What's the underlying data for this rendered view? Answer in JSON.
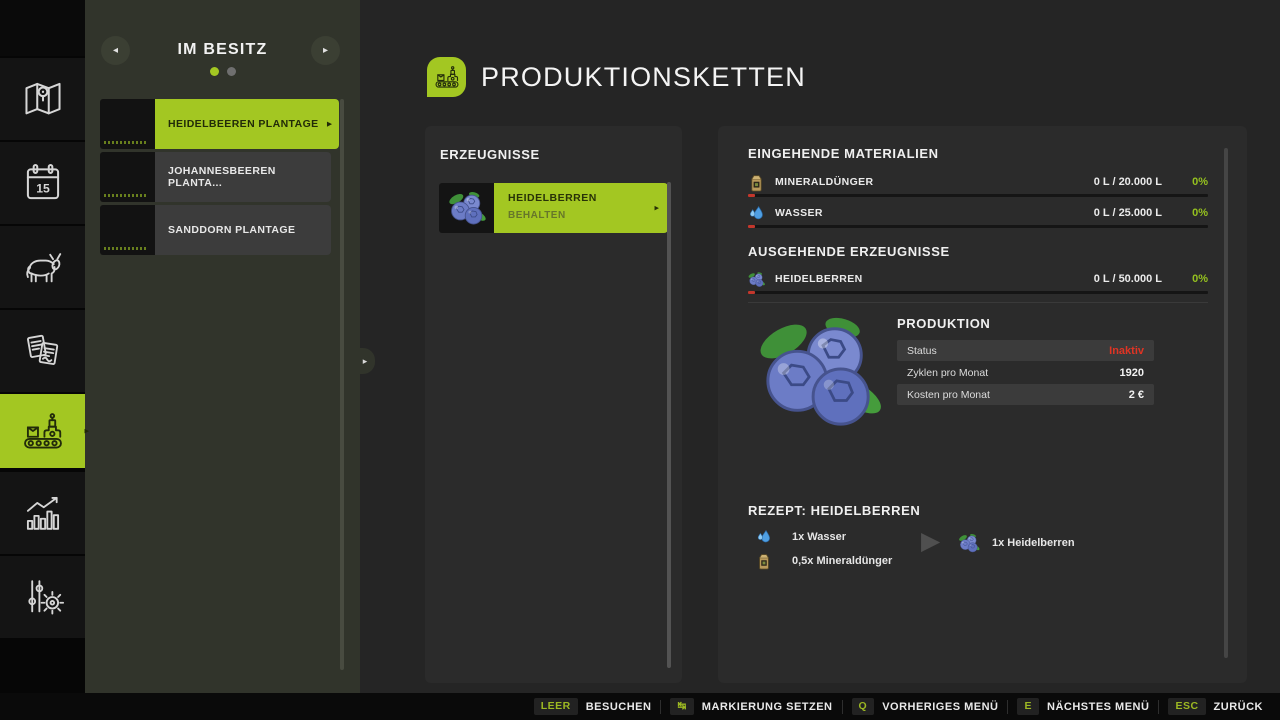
{
  "colors": {
    "accent": "#a3c722",
    "status_inactive": "#e03424",
    "percent_ok": "#95c11f"
  },
  "rail": {
    "icons": [
      "map-icon",
      "calendar-icon",
      "animals-icon",
      "contracts-icon",
      "production-icon",
      "statistics-icon",
      "settings-icon"
    ],
    "active_icon": "production-icon",
    "calendar_day": "15"
  },
  "own_panel": {
    "title": "IM BESITZ",
    "pages": 2,
    "active_page": 1,
    "items": [
      {
        "label": "HEIDELBEEREN PLANTAGE",
        "selected": true
      },
      {
        "label": "JOHANNESBEEREN PLANTA...",
        "selected": false
      },
      {
        "label": "SANDDORN PLANTAGE",
        "selected": false
      }
    ]
  },
  "header": {
    "title": "PRODUKTIONSKETTEN",
    "icon": "factory-icon"
  },
  "products": {
    "title": "ERZEUGNISSE",
    "item_name": "HEIDELBERREN",
    "item_sub": "BEHALTEN",
    "item_icon": "blueberries-icon"
  },
  "inputs": {
    "title": "EINGEHENDE MATERIALIEN",
    "rows": [
      {
        "icon": "fertilizer-icon",
        "name": "MINERALDÜNGER",
        "amount": "0 L / 20.000 L",
        "percent": "0%"
      },
      {
        "icon": "water-icon",
        "name": "WASSER",
        "amount": "0 L / 25.000 L",
        "percent": "0%"
      }
    ]
  },
  "outputs": {
    "title": "AUSGEHENDE ERZEUGNISSE",
    "rows": [
      {
        "icon": "blueberries-icon",
        "name": "HEIDELBERREN",
        "amount": "0 L / 50.000 L",
        "percent": "0%"
      }
    ]
  },
  "production": {
    "title": "PRODUKTION",
    "rows": [
      {
        "label": "Status",
        "value": "Inaktiv"
      },
      {
        "label": "Zyklen pro Monat",
        "value": "1920"
      },
      {
        "label": "Kosten pro Monat",
        "value": "2 €"
      }
    ]
  },
  "recipe": {
    "title": "REZEPT: HEIDELBERREN",
    "inputs": [
      {
        "icon": "water-icon",
        "label": "1x Wasser"
      },
      {
        "icon": "fertilizer-icon",
        "label": "0,5x Mineraldünger"
      }
    ],
    "output": {
      "icon": "blueberries-icon",
      "label": "1x Heidelberren"
    }
  },
  "bottom_bar": {
    "groups": [
      {
        "key": "LEER",
        "label": "BESUCHEN"
      },
      {
        "key": "↹",
        "label": "MARKIERUNG SETZEN"
      },
      {
        "key": "Q",
        "label": "VORHERIGES MENÜ"
      },
      {
        "key": "E",
        "label": "NÄCHSTES MENÜ"
      },
      {
        "key": "ESC",
        "label": "ZURÜCK"
      }
    ]
  }
}
